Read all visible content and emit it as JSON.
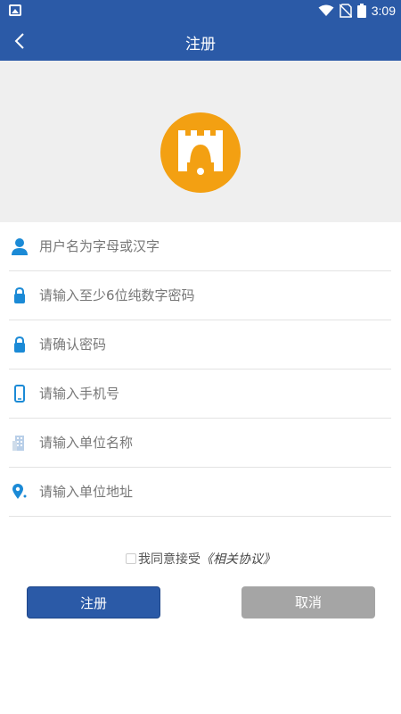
{
  "status_bar": {
    "time": "3:09"
  },
  "app_bar": {
    "title": "注册"
  },
  "form": {
    "username_placeholder": "用户名为字母或汉字",
    "password_placeholder": "请输入至少6位纯数字密码",
    "confirm_placeholder": "请确认密码",
    "phone_placeholder": "请输入手机号",
    "unit_name_placeholder": "请输入单位名称",
    "unit_address_placeholder": "请输入单位地址"
  },
  "agreement": {
    "text": "我同意接受",
    "link": "《相关协议》"
  },
  "buttons": {
    "register": "注册",
    "cancel": "取消"
  },
  "colors": {
    "primary": "#2b5aa7",
    "logo": "#f3a012",
    "cancel": "#a5a5a5",
    "icon": "#1b8ad6"
  }
}
